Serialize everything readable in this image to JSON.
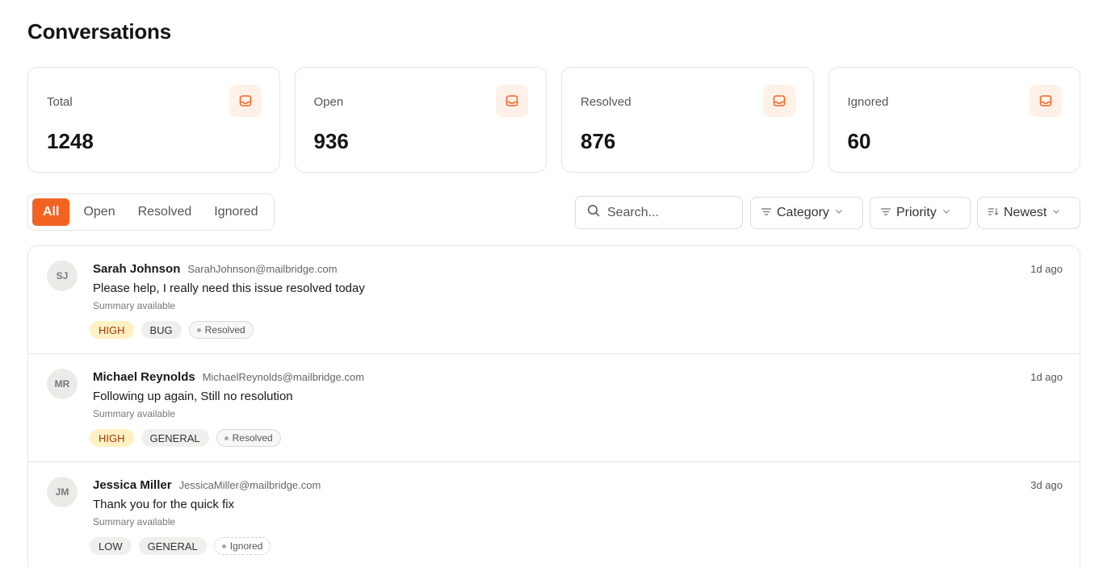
{
  "page": {
    "title": "Conversations"
  },
  "stats": [
    {
      "label": "Total",
      "value": "1248",
      "icon": "inbox-icon"
    },
    {
      "label": "Open",
      "value": "936",
      "icon": "inbox-icon"
    },
    {
      "label": "Resolved",
      "value": "876",
      "icon": "inbox-icon"
    },
    {
      "label": "Ignored",
      "value": "60",
      "icon": "inbox-icon"
    }
  ],
  "tabs": [
    {
      "label": "All",
      "active": true
    },
    {
      "label": "Open",
      "active": false
    },
    {
      "label": "Resolved",
      "active": false
    },
    {
      "label": "Ignored",
      "active": false
    }
  ],
  "search": {
    "placeholder": "Search..."
  },
  "filters": {
    "category": "Category",
    "priority": "Priority",
    "sort": "Newest"
  },
  "conversations": [
    {
      "initials": "SJ",
      "name": "Sarah Johnson",
      "email": "SarahJohnson@mailbridge.com",
      "subject": "Please help, I really need this issue resolved today",
      "summary": "Summary available",
      "priority": "HIGH",
      "category": "BUG",
      "status": "Resolved",
      "time": "1d ago"
    },
    {
      "initials": "MR",
      "name": "Michael Reynolds",
      "email": "MichaelReynolds@mailbridge.com",
      "subject": "Following up again, Still no resolution",
      "summary": "Summary available",
      "priority": "HIGH",
      "category": "GENERAL",
      "status": "Resolved",
      "time": "1d ago"
    },
    {
      "initials": "JM",
      "name": "Jessica Miller",
      "email": "JessicaMiller@mailbridge.com",
      "subject": "Thank you for the quick fix",
      "summary": "Summary available",
      "priority": "LOW",
      "category": "GENERAL",
      "status": "Ignored",
      "time": "3d ago"
    }
  ],
  "colors": {
    "accent": "#f26322",
    "accent_soft": "#fff1e8",
    "high_badge_bg": "#fff1c2",
    "border": "#e6e6e6"
  }
}
